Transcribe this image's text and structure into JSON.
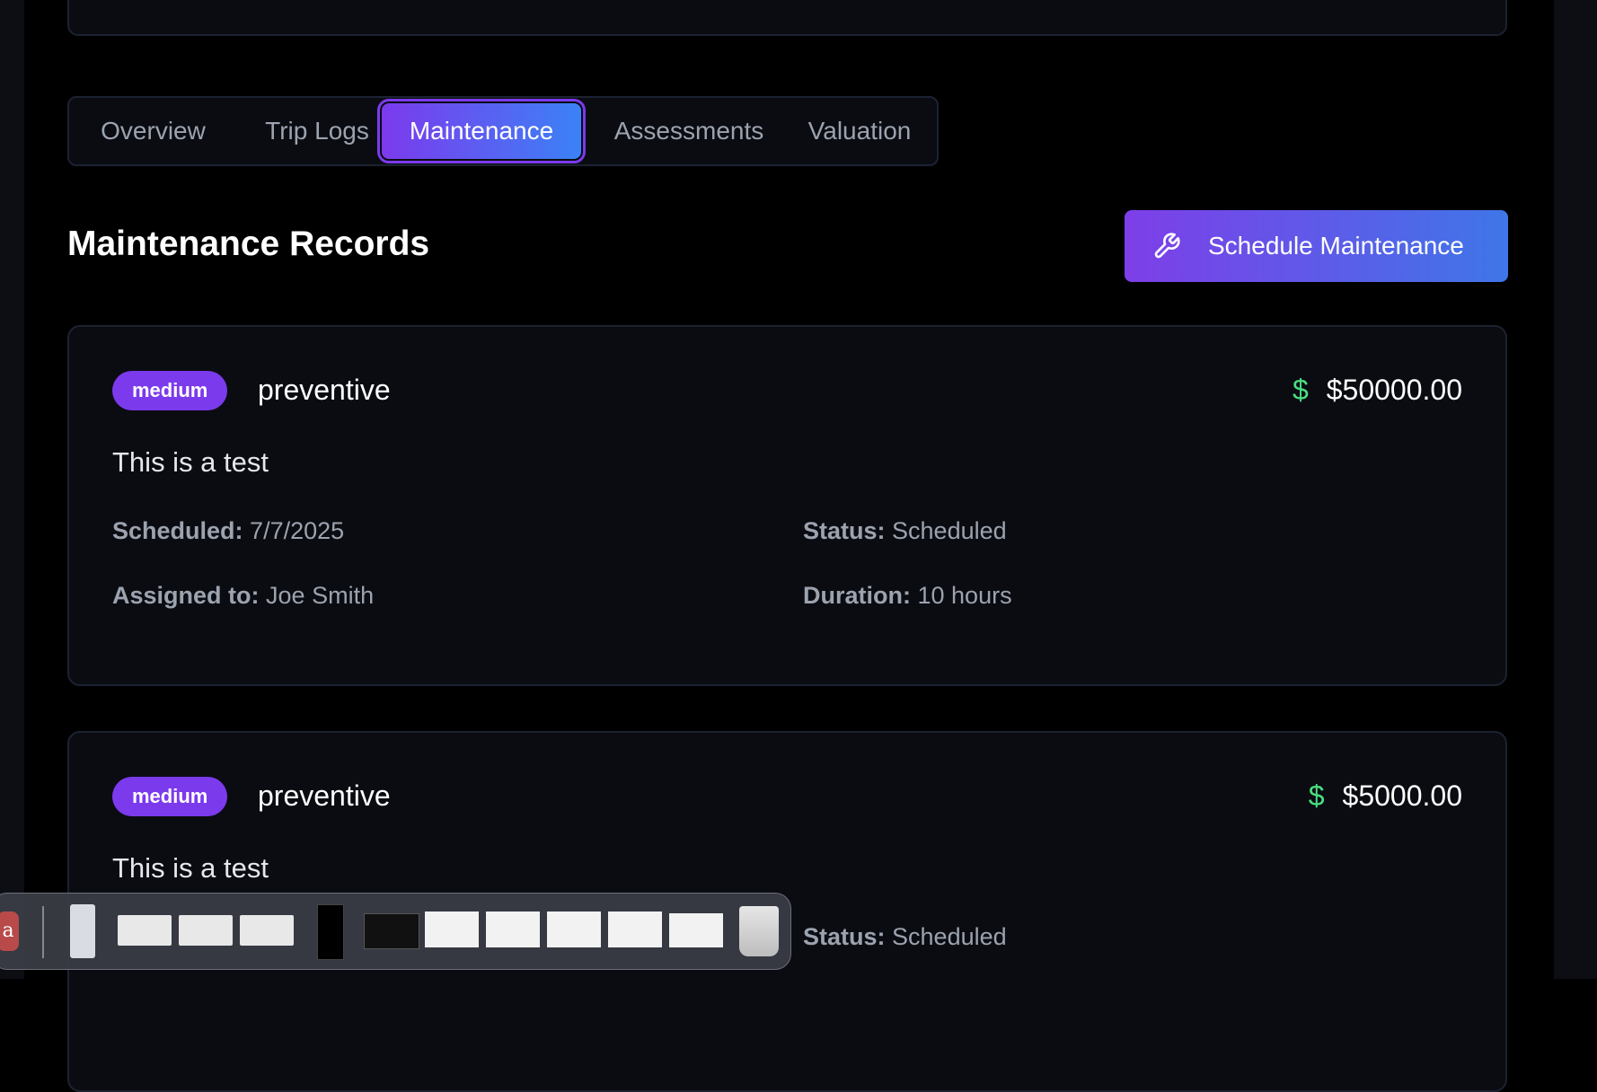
{
  "tabs": [
    {
      "label": "Overview",
      "active": false
    },
    {
      "label": "Trip Logs",
      "active": false
    },
    {
      "label": "Maintenance",
      "active": true
    },
    {
      "label": "Assessments",
      "active": false
    },
    {
      "label": "Valuation",
      "active": false
    }
  ],
  "section": {
    "title": "Maintenance Records",
    "action_label": "Schedule Maintenance",
    "action_icon": "wrench-icon"
  },
  "records": [
    {
      "priority": "medium",
      "type": "preventive",
      "cost": "$50000.00",
      "description": "This is a test",
      "scheduled_label": "Scheduled:",
      "scheduled": "7/7/2025",
      "status_label": "Status:",
      "status": "Scheduled",
      "assigned_label": "Assigned to:",
      "assigned": "Joe Smith",
      "duration_label": "Duration:",
      "duration": "10 hours"
    },
    {
      "priority": "medium",
      "type": "preventive",
      "cost": "$5000.00",
      "description": "This is a test",
      "status_label": "Status:",
      "status": "Scheduled"
    }
  ],
  "dock": {
    "partial_app_letter": "a"
  },
  "colors": {
    "accent_purple": "#7c3aed",
    "accent_blue": "#3b82f6",
    "money_green": "#4ade80",
    "card_bg": "#0a0c12"
  }
}
